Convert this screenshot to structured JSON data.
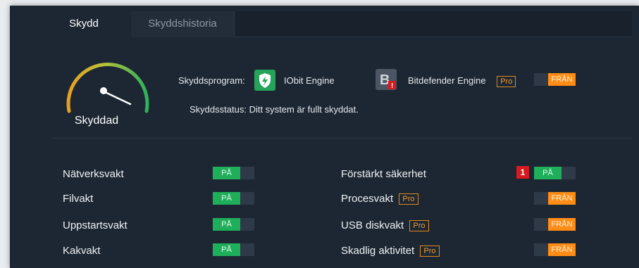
{
  "tabs": [
    {
      "label": "Skydd",
      "active": true
    },
    {
      "label": "Skyddshistoria",
      "active": false
    }
  ],
  "gauge": {
    "label": "Skyddad"
  },
  "protection": {
    "program_label": "Skyddsprogram:",
    "engines": [
      {
        "name": "IObit Engine",
        "icon": "shield-check-icon"
      },
      {
        "name": "Bitdefender Engine",
        "icon": "bitdefender-icon",
        "badge": "Pro"
      }
    ],
    "bitdefender_toggle": "FRÅN",
    "status_label": "Skyddsstatus:",
    "status_text": "Ditt system är fullt skyddat."
  },
  "guards_left": [
    {
      "label": "Nätverksvakt",
      "toggle": "PÅ",
      "state": "on"
    },
    {
      "label": "Filvakt",
      "toggle": "PÅ",
      "state": "on"
    },
    {
      "label": "Uppstartsvakt",
      "toggle": "PÅ",
      "state": "on"
    },
    {
      "label": "Kakvakt",
      "toggle": "PÅ",
      "state": "on"
    }
  ],
  "guards_right": [
    {
      "label": "Förstärkt säkerhet",
      "toggle": "PÅ",
      "state": "on",
      "badge": "1"
    },
    {
      "label": "Procesvakt",
      "toggle": "FRÅN",
      "state": "off",
      "pro": "Pro"
    },
    {
      "label": "USB diskvakt",
      "toggle": "FRÅN",
      "state": "off",
      "pro": "Pro"
    },
    {
      "label": "Skadlig aktivitet",
      "toggle": "FRÅN",
      "state": "off",
      "pro": "Pro"
    }
  ],
  "colors": {
    "background": "#1d2733",
    "on": "#1fae5a",
    "off": "#ff8c14",
    "alert": "#d71920"
  }
}
